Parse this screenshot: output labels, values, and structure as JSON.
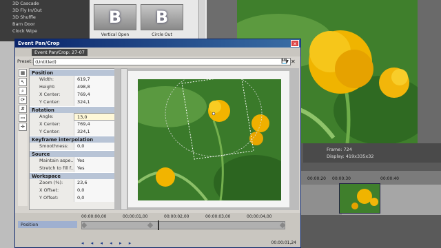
{
  "transitions": {
    "items": [
      "3D Cascade",
      "3D Fly In/Out",
      "3D Shuffle",
      "Barn Door",
      "Clock Wipe"
    ],
    "thumbs": [
      {
        "glyph": "B",
        "label": "Vertical Open"
      },
      {
        "glyph": "B",
        "label": "Circle Out"
      }
    ]
  },
  "preview_info": {
    "frame_label": "Frame:",
    "frame_value": "724",
    "display_label": "Display:",
    "display_value": "419x335x32"
  },
  "timeline": {
    "ticks": [
      "00:00:20",
      "00:00:30",
      "00:00:40"
    ]
  },
  "dialog": {
    "title": "Event Pan/Crop",
    "close": "✕",
    "tab": "Event Pan/Crop: 27-07",
    "preset_label": "Preset:",
    "preset_value": "(Untitled)",
    "preset_dropdown_glyph": "▼",
    "save_glyph": "💾",
    "delete_glyph": "✕",
    "sections": [
      {
        "title": "Position",
        "rows": [
          {
            "k": "Width:",
            "v": "619,7"
          },
          {
            "k": "Height:",
            "v": "498,8"
          },
          {
            "k": "X Center:",
            "v": "769,4"
          },
          {
            "k": "Y Center:",
            "v": "324,1"
          }
        ]
      },
      {
        "title": "Rotation",
        "rows": [
          {
            "k": "Angle:",
            "v": "13,0"
          },
          {
            "k": "X Center:",
            "v": "769,4"
          },
          {
            "k": "Y Center:",
            "v": "324,1"
          }
        ]
      },
      {
        "title": "Keyframe interpolation",
        "rows": [
          {
            "k": "Smoothness:",
            "v": "0,0"
          }
        ]
      },
      {
        "title": "Source",
        "rows": [
          {
            "k": "Maintain aspe...",
            "v": "Yes"
          },
          {
            "k": "Stretch to fill f...",
            "v": "Yes"
          }
        ]
      },
      {
        "title": "Workspace",
        "rows": [
          {
            "k": "Zoom (%):",
            "v": "23,6"
          },
          {
            "k": "X Offset:",
            "v": "0,0"
          },
          {
            "k": "Y Offset:",
            "v": "0,0"
          }
        ]
      }
    ],
    "keyframes": {
      "ticks": [
        "00:00:00,00",
        "00:00:01,00",
        "00:00:02,00",
        "00:00:03,00",
        "00:00:04,00"
      ],
      "lane_label": "Position",
      "time": "00:00:01,24",
      "controls": "◂ ◂ ◂ ◂ ▸ ▸"
    }
  }
}
